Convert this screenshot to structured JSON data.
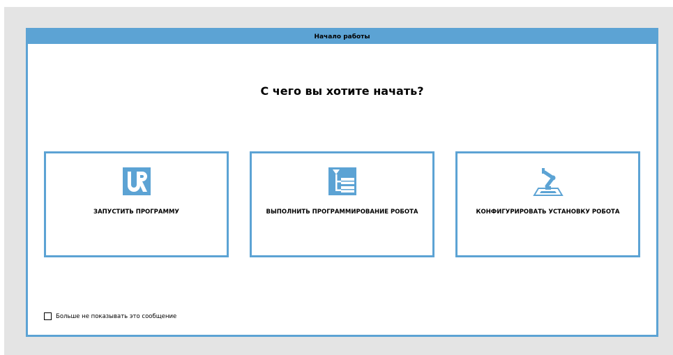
{
  "dialog": {
    "title": "Начало работы",
    "question": "С чего вы хотите начать?"
  },
  "options": [
    {
      "label": "ЗАПУСТИТЬ ПРОГРАММУ",
      "icon": "ur-logo-icon"
    },
    {
      "label": "ВЫПОЛНИТЬ ПРОГРАММИРОВАНИЕ РОБОТА",
      "icon": "program-tree-icon"
    },
    {
      "label": "КОНФИГУРИРОВАТЬ УСТАНОВКУ РОБОТА",
      "icon": "robot-arm-icon"
    }
  ],
  "footer": {
    "dont_show_label": "Больше не показывать это сообщение",
    "dont_show_checked": false
  },
  "colors": {
    "accent": "#5ca3d4",
    "backdrop": "#e4e4e4"
  }
}
